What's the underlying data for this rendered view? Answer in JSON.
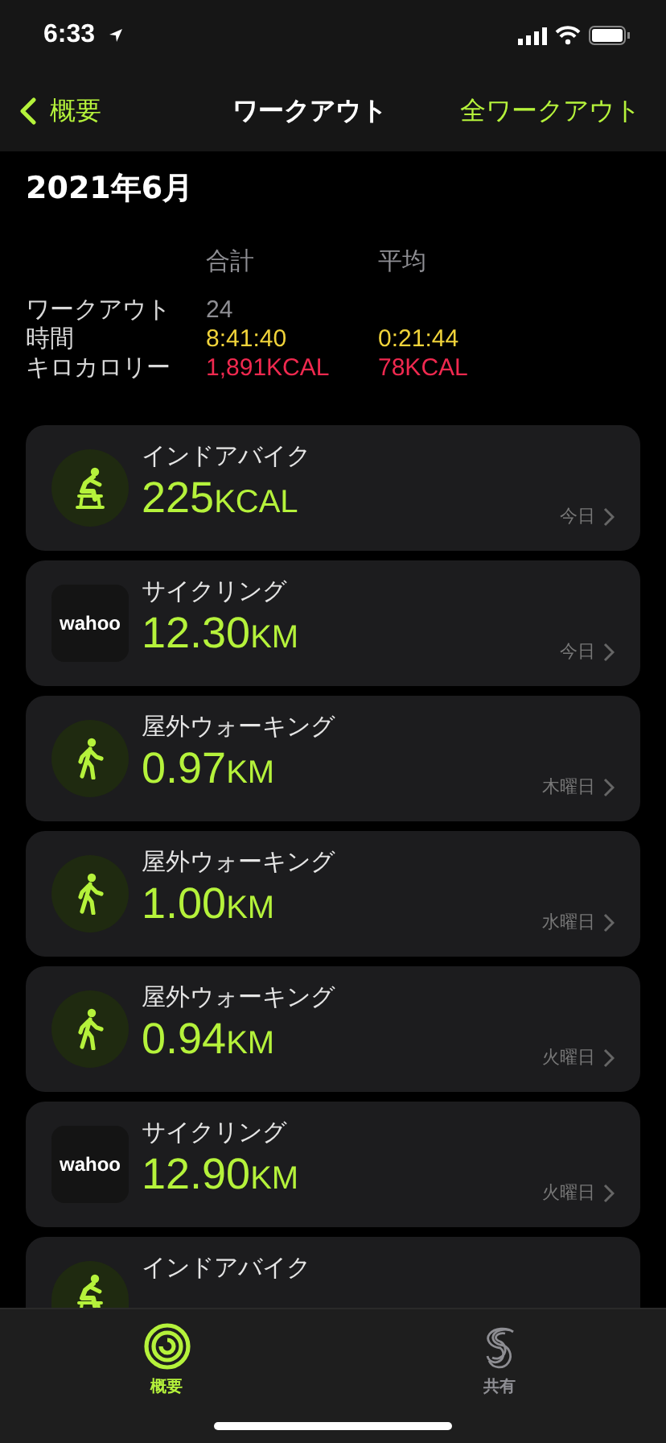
{
  "status_bar": {
    "time": "6:33"
  },
  "nav": {
    "back": "概要",
    "title": "ワークアウト",
    "action": "全ワークアウト"
  },
  "month": "2021年6月",
  "summary": {
    "columns": [
      "合計",
      "平均"
    ],
    "rows": [
      {
        "label": "ワークアウト",
        "kind": "count",
        "total": "24",
        "average": ""
      },
      {
        "label": "時間",
        "kind": "time",
        "total": "8:41:40",
        "average": "0:21:44"
      },
      {
        "label": "キロカロリー",
        "kind": "energy",
        "total": "1,891KCAL",
        "average": "78KCAL"
      }
    ]
  },
  "workouts": [
    {
      "kind": "bike",
      "title": "インドアバイク",
      "value": "225",
      "unit": "KCAL",
      "day": "今日"
    },
    {
      "kind": "logo",
      "logo": "wahoo",
      "title": "サイクリング",
      "value": "12.30",
      "unit": "KM",
      "day": "今日"
    },
    {
      "kind": "walk",
      "title": "屋外ウォーキング",
      "value": "0.97",
      "unit": "KM",
      "day": "木曜日"
    },
    {
      "kind": "walk",
      "title": "屋外ウォーキング",
      "value": "1.00",
      "unit": "KM",
      "day": "水曜日"
    },
    {
      "kind": "walk",
      "title": "屋外ウォーキング",
      "value": "0.94",
      "unit": "KM",
      "day": "火曜日"
    },
    {
      "kind": "logo",
      "logo": "wahoo",
      "title": "サイクリング",
      "value": "12.90",
      "unit": "KM",
      "day": "火曜日"
    },
    {
      "kind": "bike",
      "title": "インドアバイク"
    }
  ],
  "tabs": [
    {
      "kind": "rings",
      "label": "概要",
      "selected": true
    },
    {
      "kind": "share",
      "label": "共有",
      "selected": false
    }
  ]
}
